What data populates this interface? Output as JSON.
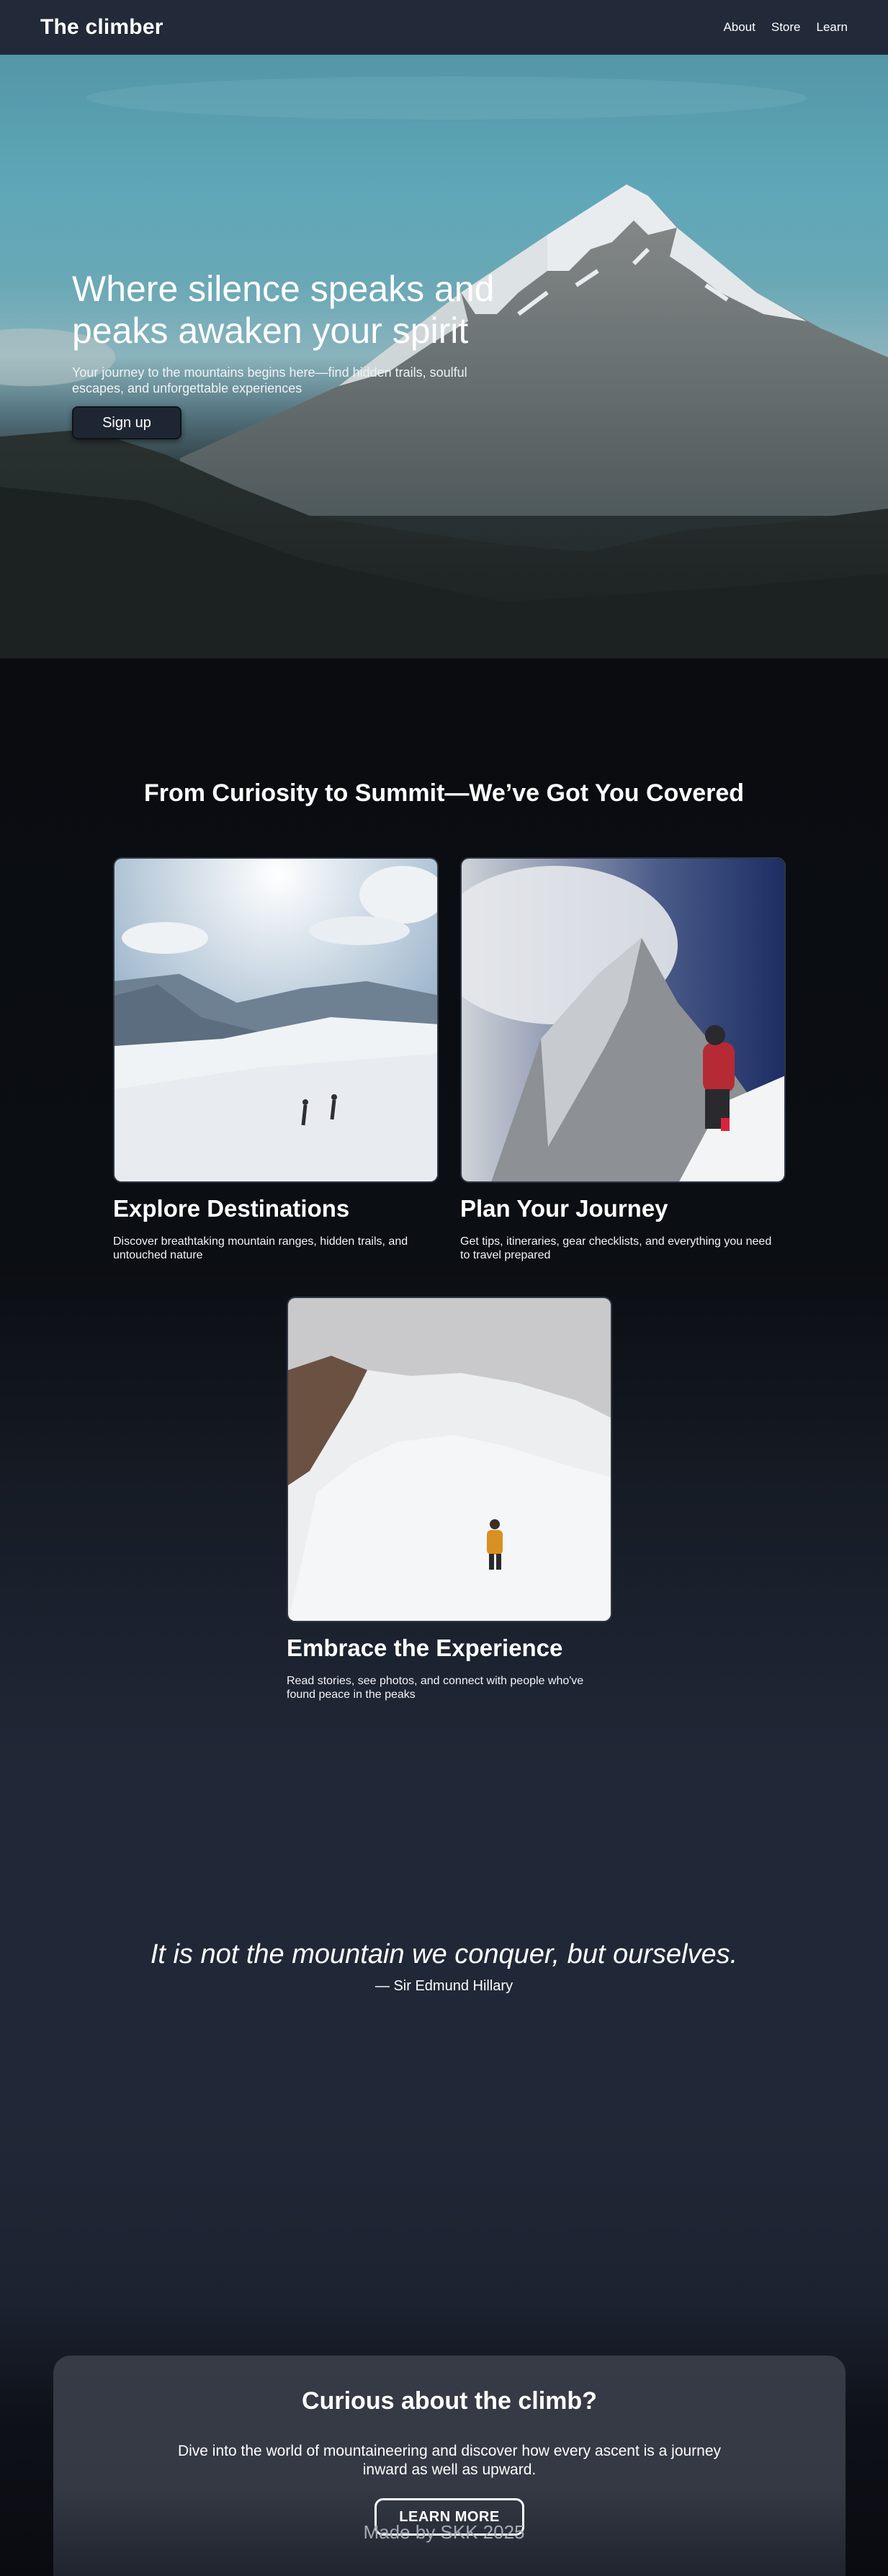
{
  "nav": {
    "brand": "The climber",
    "links": [
      "About",
      "Store",
      "Learn"
    ]
  },
  "hero": {
    "title": "Where silence speaks and peaks awaken your spirit",
    "subtitle": "Your journey to the mountains begins here—find hidden trails, soulful escapes, and unforgettable experiences",
    "button": "Sign up"
  },
  "features": {
    "title": "From Curiosity to Summit—We’ve Got You Covered",
    "cards": [
      {
        "title": "Explore Destinations",
        "desc": "Discover breathtaking mountain ranges, hidden trails, and untouched nature"
      },
      {
        "title": "Plan Your Journey",
        "desc": "Get tips, itineraries, gear checklists, and everything you need to travel prepared"
      },
      {
        "title": "Embrace the Experience",
        "desc": "Read stories, see photos, and connect with people who've found peace in the peaks"
      }
    ]
  },
  "quote": {
    "text": "It is not the mountain we conquer, but ourselves.",
    "author": "— Sir Edmund Hillary"
  },
  "cta": {
    "title": "Curious about the climb?",
    "text": "Dive into the world of mountaineering and discover how every ascent is a journey inward as well as upward.",
    "button": "LEARN MORE"
  },
  "footer": "Made by SKK 2025",
  "colors": {
    "nav_bg": "#222a39",
    "dark_bg": "#0b0d12",
    "section_bg": "#202837",
    "cta_card": "#373b46"
  }
}
